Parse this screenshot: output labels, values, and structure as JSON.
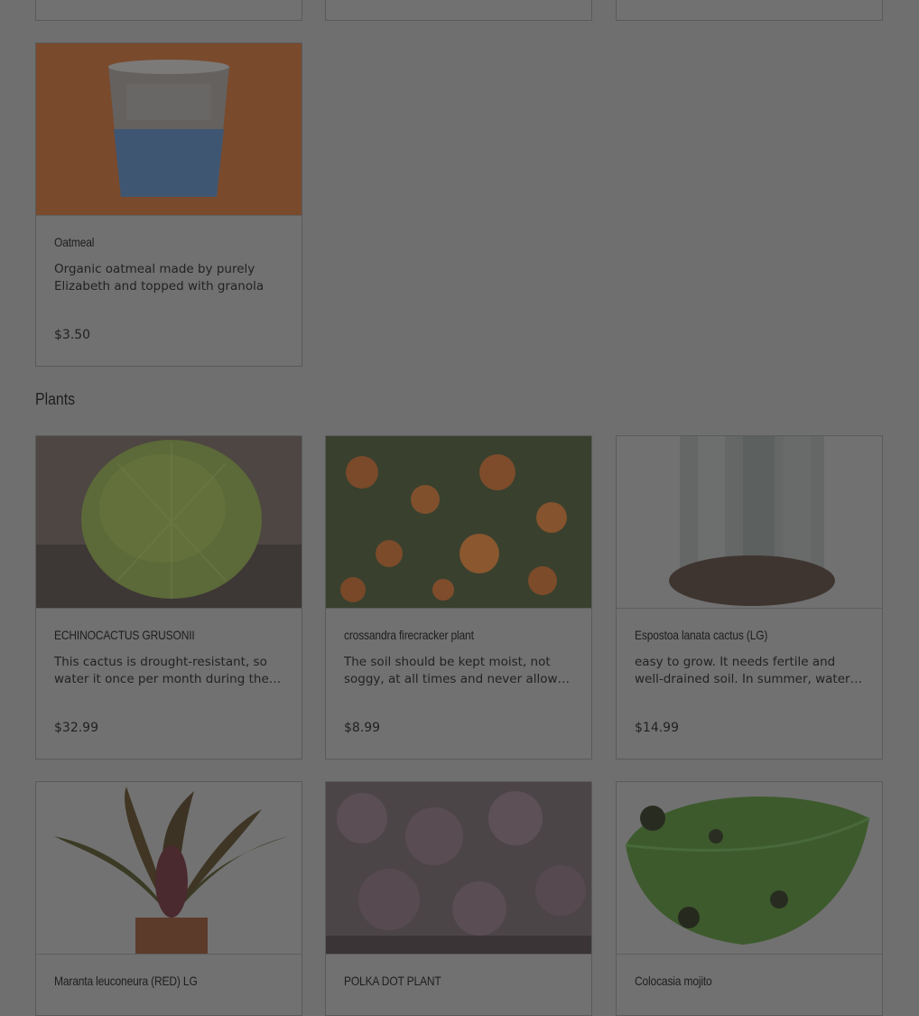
{
  "sections": {
    "plants_title": "Plants"
  },
  "top_products": [
    {
      "name": "Oatmeal",
      "description": "Organic oatmeal made by purely Elizabeth and topped with granola",
      "price": "$3.50"
    }
  ],
  "plants": [
    {
      "name": "ECHINOCACTUS GRUSONII",
      "description": "This cactus is drought-resistant, so water it once per month during the…",
      "price": "$32.99"
    },
    {
      "name": "crossandra firecracker plant",
      "description": "The soil should be kept moist, not soggy, at all times and never allowed t…",
      "price": "$8.99"
    },
    {
      "name": "Espostoa lanata cactus (LG)",
      "description": "easy to grow. It needs fertile and well-drained soil. In summer, water the…",
      "price": "$14.99"
    },
    {
      "name": "Maranta leuconeura (RED) LG"
    },
    {
      "name": "POLKA DOT PLANT"
    },
    {
      "name": "Colocasia mojito"
    }
  ]
}
